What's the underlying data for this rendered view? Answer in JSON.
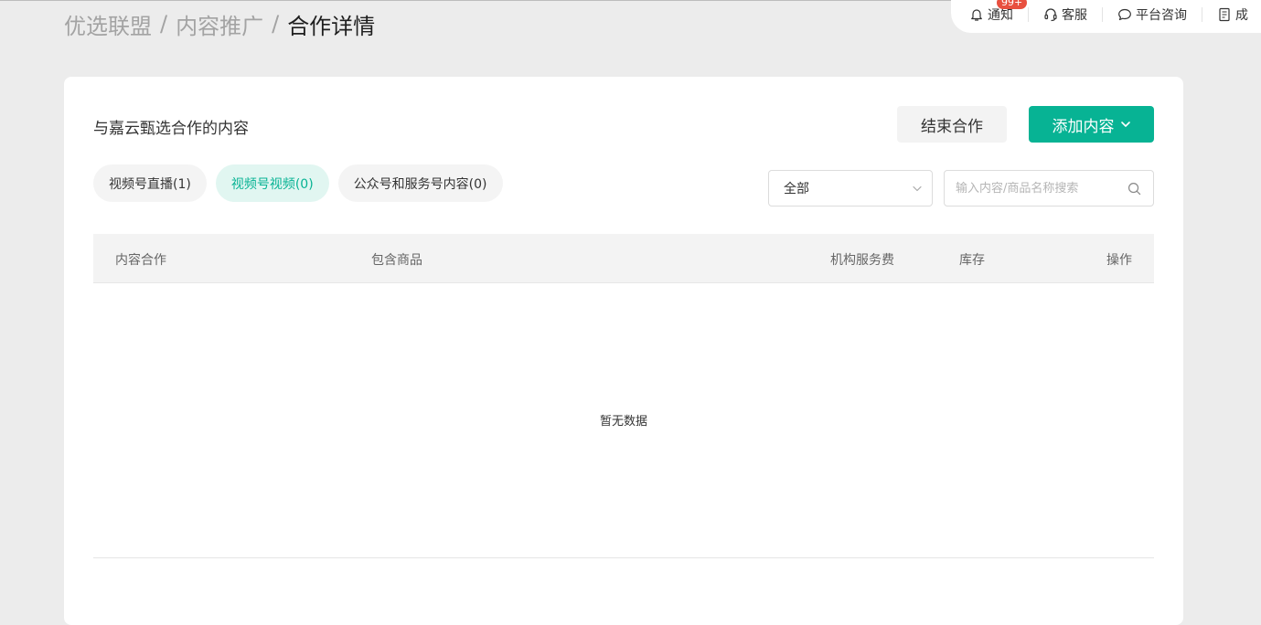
{
  "breadcrumb": {
    "items": [
      "优选联盟",
      "内容推广"
    ],
    "separator": "/",
    "current": "合作详情"
  },
  "topbar": {
    "notification": {
      "label": "通知",
      "badge": "99+",
      "icon": "bell-icon"
    },
    "service": {
      "label": "客服",
      "icon": "headset-icon"
    },
    "consult": {
      "label": "平台咨询",
      "icon": "chat-bubble-icon"
    },
    "truncated": {
      "label": "成",
      "icon": "document-icon"
    }
  },
  "card": {
    "title": "与嘉云甄选合作的内容",
    "end_button": "结束合作",
    "add_button": "添加内容"
  },
  "tabs": [
    {
      "label": "视频号直播(1)",
      "active": false
    },
    {
      "label": "视频号视频(0)",
      "active": true
    },
    {
      "label": "公众号和服务号内容(0)",
      "active": false
    }
  ],
  "filter": {
    "select_value": "全部",
    "search_placeholder": "输入内容/商品名称搜索"
  },
  "table": {
    "columns": [
      "内容合作",
      "包含商品",
      "机构服务费",
      "库存",
      "操作"
    ],
    "empty_text": "暂无数据"
  },
  "colors": {
    "accent": "#07b394",
    "badge": "#e8503f",
    "background": "#ececec"
  }
}
